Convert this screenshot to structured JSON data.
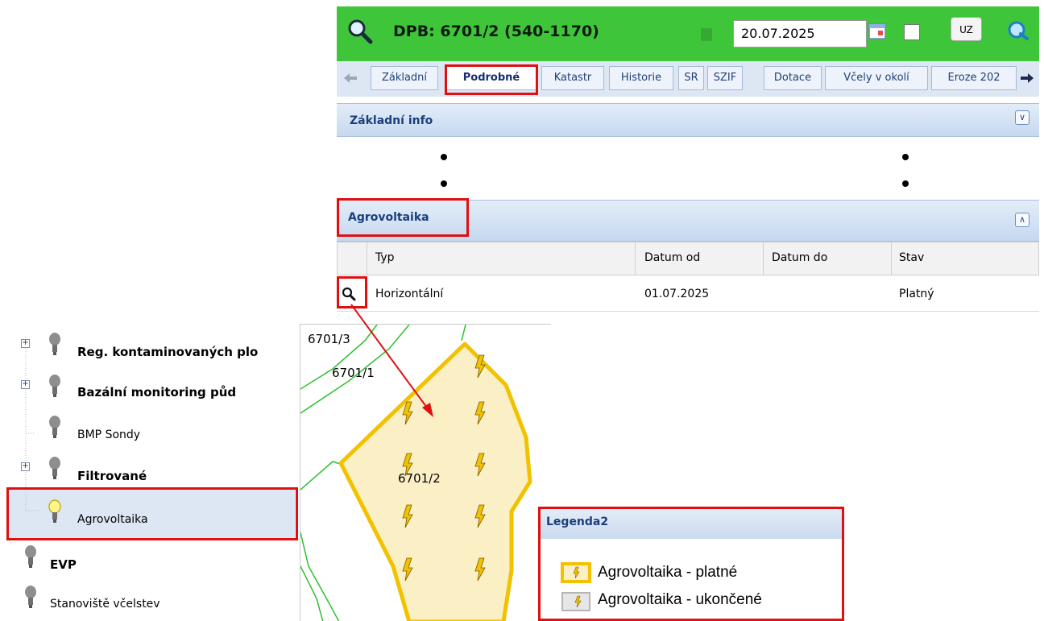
{
  "header": {
    "title": "DPB: 6701/2 (540-1170)",
    "date": "20.07.2025",
    "uz_button": "UZ"
  },
  "tabs": [
    {
      "label": "Základní",
      "active": false
    },
    {
      "label": "Podrobné",
      "active": true
    },
    {
      "label": "Katastr",
      "active": false
    },
    {
      "label": "Historie",
      "active": false
    },
    {
      "label": "SR",
      "active": false
    },
    {
      "label": "SZIF",
      "active": false
    },
    {
      "label": "Dotace",
      "active": false
    },
    {
      "label": "Včely v okolí",
      "active": false
    },
    {
      "label": "Eroze 202",
      "active": false
    }
  ],
  "sections": {
    "basic_info": "Základní info",
    "agrovoltaika": "Agrovoltaika"
  },
  "table": {
    "columns": [
      "Typ",
      "Datum od",
      "Datum do",
      "Stav"
    ],
    "rows": [
      {
        "typ": "Horizontální",
        "datum_od": "01.07.2025",
        "datum_do": "",
        "stav": "Platný"
      }
    ]
  },
  "layer_tree": [
    {
      "label": "Reg. kontaminovaných plo",
      "bold": true,
      "expandable": true
    },
    {
      "label": "Bazální monitoring půd",
      "bold": true,
      "expandable": true
    },
    {
      "label": "BMP Sondy",
      "bold": false,
      "expandable": false
    },
    {
      "label": "Filtrované",
      "bold": true,
      "expandable": true
    },
    {
      "label": "Agrovoltaika",
      "bold": false,
      "expandable": false,
      "selected": true
    },
    {
      "label": "EVP",
      "bold": true,
      "expandable": false
    },
    {
      "label": "Stanoviště včelstev",
      "bold": false,
      "expandable": false
    }
  ],
  "map": {
    "parcels": [
      "6701/3",
      "6701/1",
      "6701/2"
    ]
  },
  "legend": {
    "title": "Legenda2",
    "items": [
      "Agrovoltaika - platné",
      "Agrovoltaika - ukončené"
    ]
  },
  "colors": {
    "header_green": "#3fc53a",
    "highlight_red": "#e01010",
    "parcel_outline": "#f2c200",
    "parcel_fill": "#fbefc6",
    "cadastre_lines": "#2fbf2f"
  }
}
